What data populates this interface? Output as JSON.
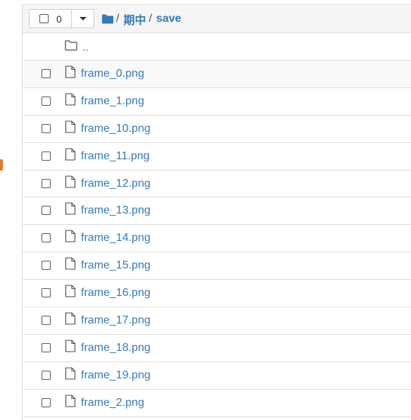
{
  "toolbar": {
    "selected_count": "0"
  },
  "breadcrumb": {
    "sep1": "/",
    "crumb1": "期中",
    "sep2": "/",
    "crumb2": "save"
  },
  "parent_dir": {
    "label": ".."
  },
  "files": [
    "frame_0.png",
    "frame_1.png",
    "frame_10.png",
    "frame_11.png",
    "frame_12.png",
    "frame_13.png",
    "frame_14.png",
    "frame_15.png",
    "frame_16.png",
    "frame_17.png",
    "frame_18.png",
    "frame_19.png",
    "frame_2.png"
  ],
  "colors": {
    "link": "#337ab7",
    "border": "#dddddd",
    "header_bg": "#f5f5f5"
  }
}
